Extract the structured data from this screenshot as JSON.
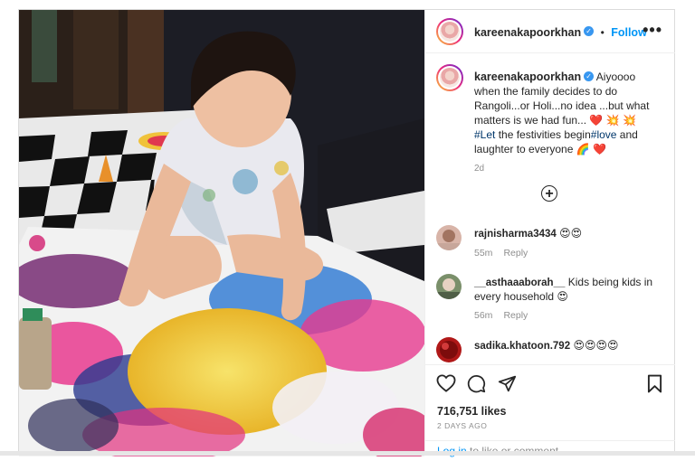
{
  "post": {
    "username": "kareenakapoorkhan",
    "follow_label": "Follow",
    "more_icon": "more-horizontal-icon",
    "caption": {
      "username": "kareenakapoorkhan",
      "text_1": "Aiyoooo when the family decides to do Rangoli...or Holi...no idea ...but what matters is we had fun...",
      "emoji_1": "❤️ 💥 💥",
      "hashtag_1": "#Let",
      "text_2": " the festivities begin",
      "hashtag_2": "#love",
      "text_3": " and laughter to everyone ",
      "emoji_2": "🌈 ❤️",
      "age": "2d"
    },
    "load_more_icon": "plus-circle-icon",
    "comments": [
      {
        "username": "rajnisharma3434",
        "text": "😍😍",
        "time": "55m",
        "reply": "Reply",
        "avatar_color": "#d8b4a8"
      },
      {
        "username": "__asthaaaborah__",
        "text": "Kids being kids in every household 😍",
        "time": "56m",
        "reply": "Reply",
        "avatar_color": "#7a8f6a"
      },
      {
        "username": "sadika.khatoon.792",
        "text": "😍😍😍😍",
        "time": "",
        "reply": "",
        "avatar_color": "#b01818"
      }
    ],
    "likes": "716,751 likes",
    "posted_ago": "2 DAYS AGO",
    "login_link": "Log in",
    "login_text": " to like or comment.",
    "colors": {
      "accent": "#0095f6",
      "verified": "#3897f0",
      "muted": "#8e8e8e",
      "heart": "#ed4956"
    }
  }
}
